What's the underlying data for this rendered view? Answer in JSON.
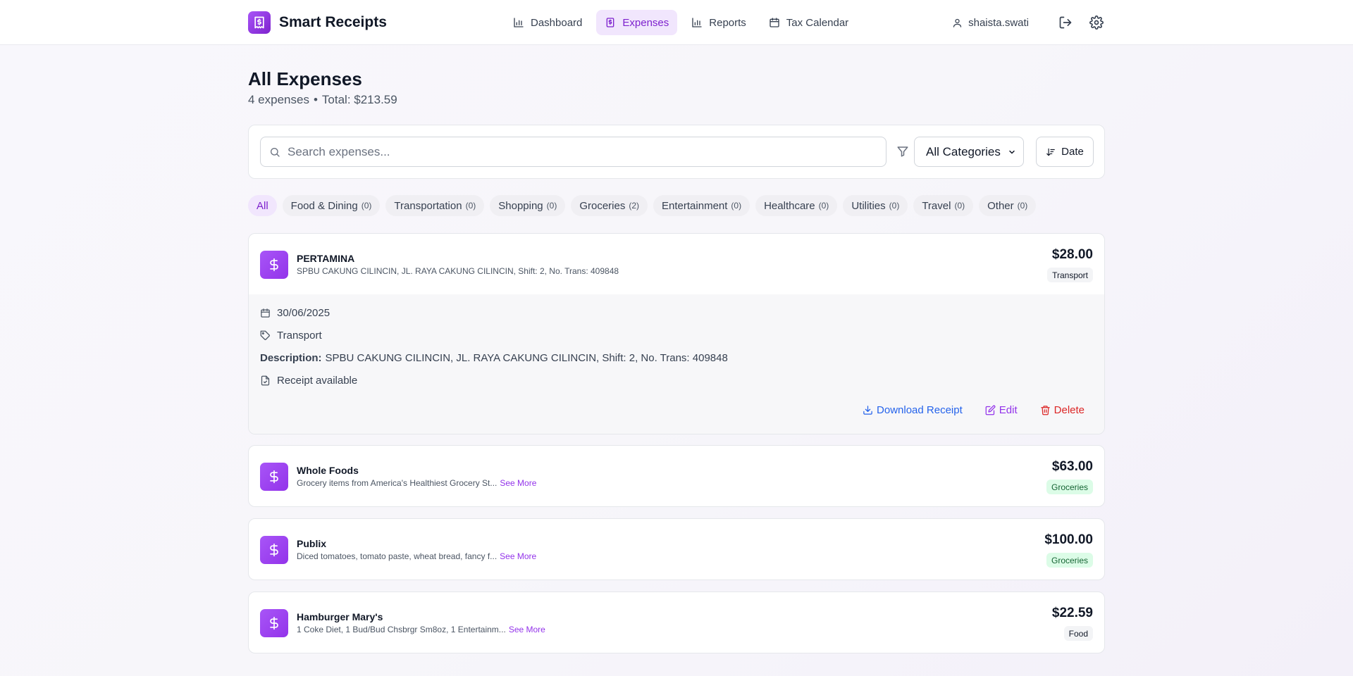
{
  "app": {
    "name": "Smart Receipts"
  },
  "nav": {
    "links": [
      {
        "label": "Dashboard",
        "icon": "bar-chart-icon",
        "active": false
      },
      {
        "label": "Expenses",
        "icon": "receipt-icon",
        "active": true
      },
      {
        "label": "Reports",
        "icon": "bar-chart-icon",
        "active": false
      },
      {
        "label": "Tax Calendar",
        "icon": "calendar-icon",
        "active": false
      }
    ],
    "username": "shaista.swati"
  },
  "page": {
    "title": "All Expenses",
    "count_text": "4 expenses",
    "separator": "•",
    "total_text": "Total: $213.59"
  },
  "toolbar": {
    "search_placeholder": "Search expenses...",
    "category_selected": "All Categories",
    "sort_label": "Date"
  },
  "categories": [
    {
      "label": "All",
      "count": ""
    },
    {
      "label": "Food & Dining",
      "count": "(0)"
    },
    {
      "label": "Transportation",
      "count": "(0)"
    },
    {
      "label": "Shopping",
      "count": "(0)"
    },
    {
      "label": "Groceries",
      "count": "(2)"
    },
    {
      "label": "Entertainment",
      "count": "(0)"
    },
    {
      "label": "Healthcare",
      "count": "(0)"
    },
    {
      "label": "Utilities",
      "count": "(0)"
    },
    {
      "label": "Travel",
      "count": "(0)"
    },
    {
      "label": "Other",
      "count": "(0)"
    }
  ],
  "expenses": [
    {
      "merchant": "PERTAMINA",
      "description": "SPBU CAKUNG CILINCIN, JL. RAYA CAKUNG CILINCIN, Shift: 2, No. Trans: 409848",
      "amount": "$28.00",
      "category": "Transport",
      "expanded": {
        "date": "30/06/2025",
        "category": "Transport",
        "description_label": "Description:",
        "description": "SPBU CAKUNG CILINCIN, JL. RAYA CAKUNG CILINCIN, Shift: 2, No. Trans: 409848",
        "receipt_text": "Receipt available",
        "download_label": "Download Receipt",
        "edit_label": "Edit",
        "delete_label": "Delete"
      }
    },
    {
      "merchant": "Whole Foods",
      "description": "Grocery items from America's Healthiest Grocery St...",
      "see_more": "See More",
      "amount": "$63.00",
      "category": "Groceries"
    },
    {
      "merchant": "Publix",
      "description": "Diced tomatoes, tomato paste, wheat bread, fancy f...",
      "see_more": "See More",
      "amount": "$100.00",
      "category": "Groceries"
    },
    {
      "merchant": "Hamburger Mary's",
      "description": "1 Coke Diet, 1 Bud/Bud Chsbrgr Sm8oz, 1 Entertainm...",
      "see_more": "See More",
      "amount": "$22.59",
      "category": "Food"
    }
  ],
  "colors": {
    "accent": "#9333ea",
    "accent_bg": "#f1e6fd",
    "link_blue": "#2563eb",
    "danger": "#dc2626",
    "groceries_badge": "#dcfce7"
  }
}
